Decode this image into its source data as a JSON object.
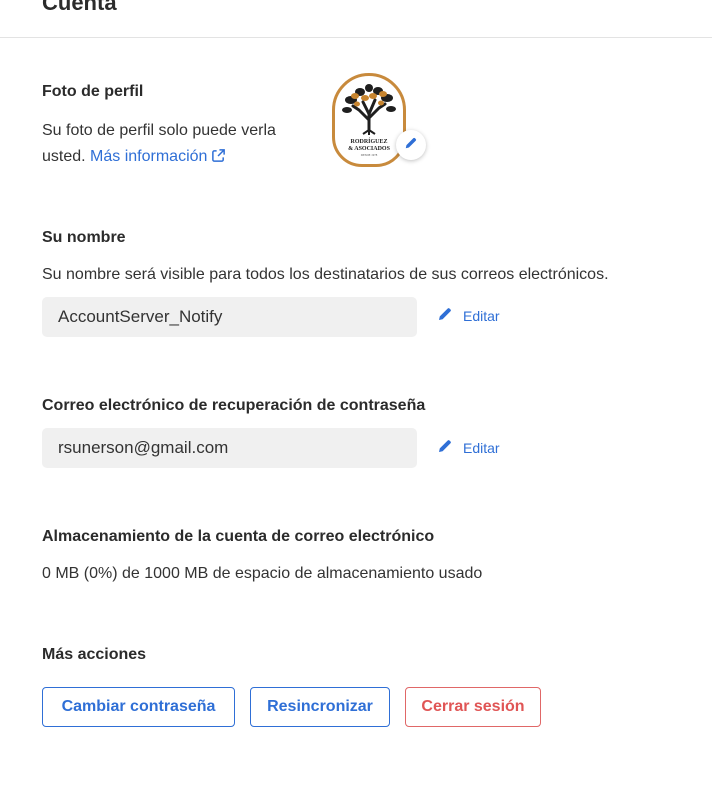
{
  "header": {
    "title": "Cuenta"
  },
  "profile_photo": {
    "title": "Foto de perfil",
    "description": "Su foto de perfil solo puede verla usted.",
    "description_line1": "Su foto de perfil solo puede verla",
    "description_line2": "usted.",
    "more_info_link": "Más información",
    "avatar_logo_text": {
      "line1": "RODRÍGUEZ",
      "line2": "& ASOCIADOS",
      "line3": "DESDE 1978"
    },
    "logo_colors": {
      "border": "#c88a3c",
      "tree": "#1f1f1f",
      "leaves": "#c8852f"
    }
  },
  "name": {
    "title": "Su nombre",
    "description": "Su nombre será visible para todos los destinatarios de sus correos electrónicos.",
    "value": "AccountServer_Notify",
    "edit_label": "Editar"
  },
  "recovery_email": {
    "title": "Correo electrónico de recuperación de contraseña",
    "value": "rsunerson@gmail.com",
    "edit_label": "Editar"
  },
  "storage": {
    "title": "Almacenamiento de la cuenta de correo electrónico",
    "description": "0 MB (0%) de 1000 MB de espacio de almacenamiento usado"
  },
  "more_actions": {
    "title": "Más acciones",
    "change_password_label": "Cambiar contraseña",
    "resync_label": "Resincronizar",
    "logout_label": "Cerrar sesión"
  },
  "colors": {
    "accent": "#2f6fd6",
    "danger": "#e05555",
    "field_bg": "#f0f0f0"
  },
  "icons": {
    "avatar_edit": "pencil-icon",
    "external_link": "external-link-icon",
    "name_edit": "pencil-icon",
    "email_edit": "pencil-icon"
  }
}
